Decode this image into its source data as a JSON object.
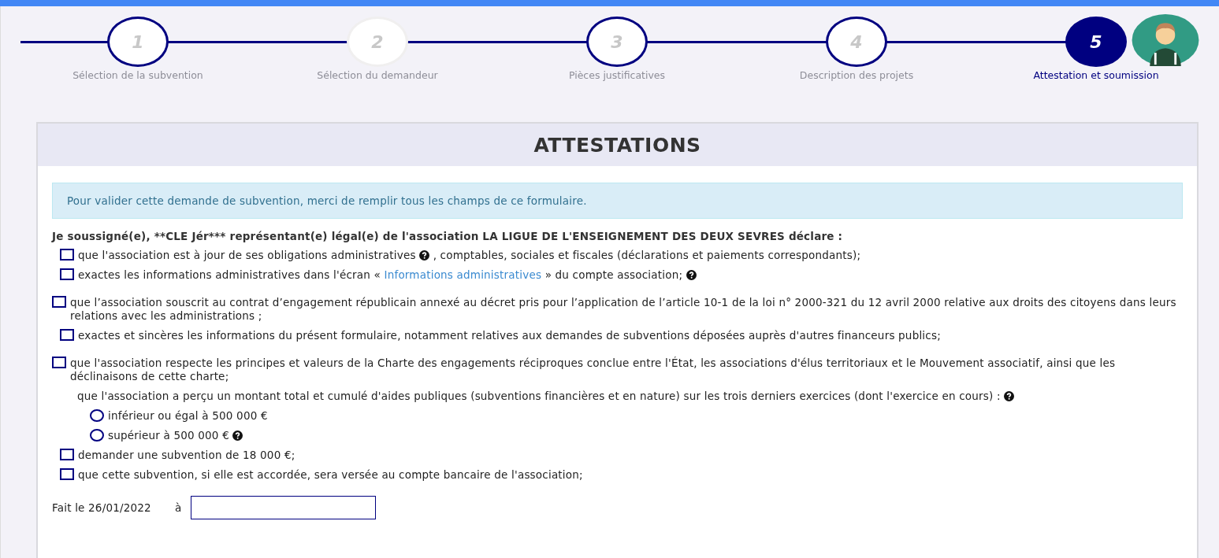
{
  "steps": [
    {
      "number": "1",
      "label": "Sélection de la subvention",
      "completed": true,
      "selected": false
    },
    {
      "number": "2",
      "label": "Sélection du demandeur",
      "completed": false,
      "selected": false
    },
    {
      "number": "3",
      "label": "Pièces justificatives",
      "completed": true,
      "selected": false
    },
    {
      "number": "4",
      "label": "Description des projets",
      "completed": true,
      "selected": false
    },
    {
      "number": "5",
      "label": "Attestation et soumission",
      "completed": true,
      "selected": true
    }
  ],
  "card": {
    "title": "ATTESTATIONS",
    "alert": "Pour valider cette demande de subvention, merci de remplir tous les champs de ce formulaire.",
    "intro": "Je soussigné(e), **CLE Jér*** représentant(e) légal(e) de l'association LA LIGUE DE L'ENSEIGNEMENT DES DEUX SEVRES déclare :",
    "groups": [
      [
        {
          "kind": "checkbox",
          "checked": false,
          "parts": [
            {
              "kind": "text",
              "text": "que l'association est à jour de ses obligations administratives "
            },
            {
              "kind": "help"
            },
            {
              "kind": "text",
              "text": " , comptables, sociales et fiscales (déclarations et paiements correspondants);"
            }
          ]
        },
        {
          "kind": "checkbox",
          "checked": false,
          "parts": [
            {
              "kind": "text",
              "text": "exactes les informations administratives dans l'écran « "
            },
            {
              "kind": "link",
              "text": "Informations administratives"
            },
            {
              "kind": "text",
              "text": " » du compte association; "
            },
            {
              "kind": "help"
            }
          ]
        }
      ],
      [
        {
          "kind": "checkbox",
          "checked": false,
          "parts": [
            {
              "kind": "text",
              "text": "que l’association souscrit au contrat d’engagement républicain annexé au décret pris pour l’application de l’article 10-1 de la loi n° 2000-321 du 12 avril 2000 relative aux droits des citoyens dans leurs relations avec les administrations ;"
            }
          ]
        },
        {
          "kind": "checkbox",
          "checked": false,
          "parts": [
            {
              "kind": "text",
              "text": "exactes et sincères les informations du présent formulaire, notamment relatives aux demandes de subventions déposées auprès d'autres financeurs publics;"
            }
          ]
        }
      ],
      [
        {
          "kind": "checkbox",
          "checked": false,
          "parts": [
            {
              "kind": "text",
              "text": "que l'association respecte les principes et valeurs de la Charte des engagements réciproques conclue entre l'État, les associations d'élus territoriaux et le Mouvement associatif, ainsi que les déclinaisons de cette charte;"
            }
          ]
        },
        {
          "kind": "question",
          "parts": [
            {
              "kind": "text",
              "text": "que l'association a perçu un montant total et cumulé d'aides publiques (subventions financières et en nature) sur les trois derniers exercices (dont l'exercice en cours) : "
            },
            {
              "kind": "help"
            }
          ]
        },
        {
          "kind": "radio",
          "selected": false,
          "parts": [
            {
              "kind": "text",
              "text": "inférieur ou égal à 500 000 €"
            }
          ]
        },
        {
          "kind": "radio",
          "selected": false,
          "parts": [
            {
              "kind": "text",
              "text": "supérieur à 500 000 € "
            },
            {
              "kind": "help"
            }
          ]
        },
        {
          "kind": "checkbox",
          "checked": false,
          "parts": [
            {
              "kind": "text",
              "text": "demander une subvention de 18 000 €;"
            }
          ]
        },
        {
          "kind": "checkbox",
          "checked": false,
          "parts": [
            {
              "kind": "text",
              "text": "que cette subvention, si elle est accordée, sera versée au compte bancaire de l'association;"
            }
          ]
        }
      ]
    ],
    "date_label": "Fait le 26/01/2022",
    "place_label": "à"
  }
}
